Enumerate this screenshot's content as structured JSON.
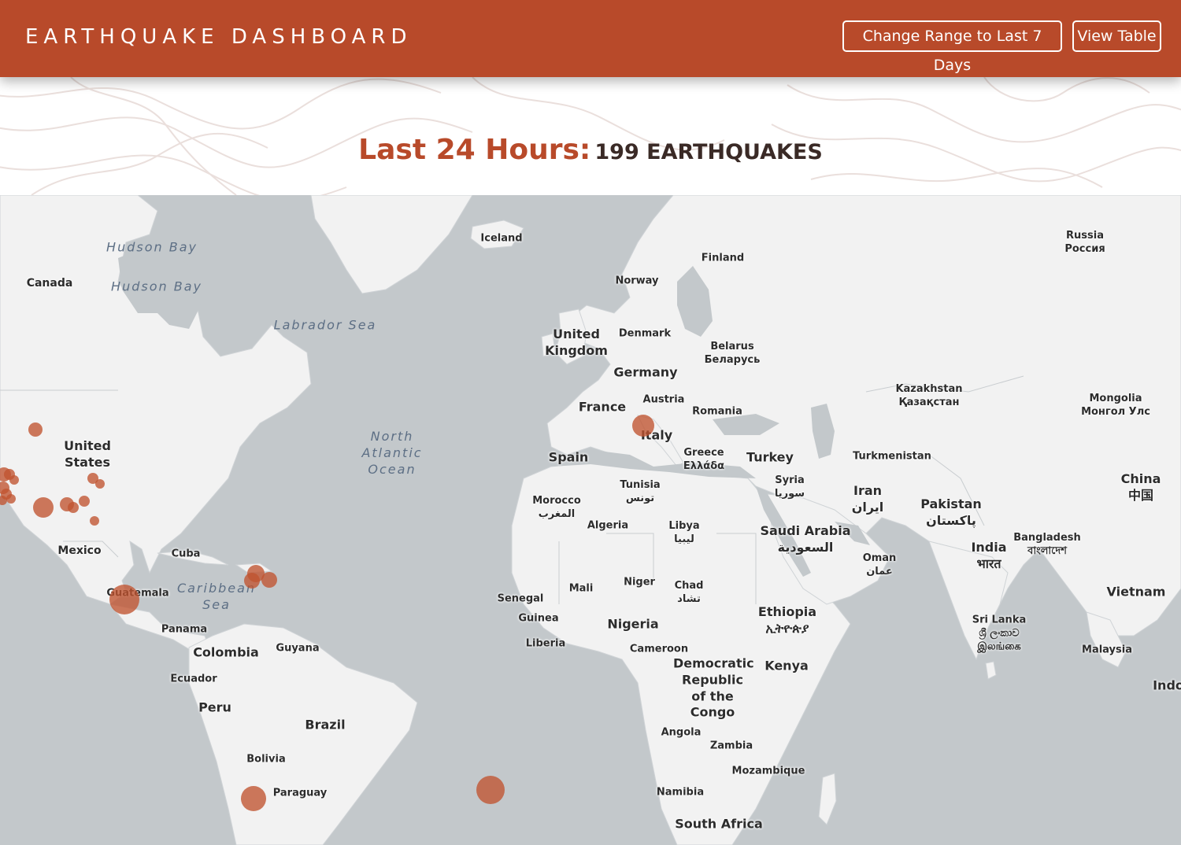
{
  "header": {
    "title": "EARTHQUAKE DASHBOARD",
    "range_button": "Change Range to Last 7 Days",
    "table_button": "View Table",
    "bg_color": "#b84a2a"
  },
  "summary": {
    "range_label": "Last 24 Hours:",
    "count_label": "199 EARTHQUAKES",
    "accent_color": "#b84a2a"
  },
  "map": {
    "ocean_color": "#c3c8cb",
    "land_color": "#f2f2f2",
    "marker_color": "#c0532f",
    "labels": {
      "canada": "Canada",
      "united_states": "United States",
      "mexico": "Mexico",
      "cuba": "Cuba",
      "guatemala": "Guatemala",
      "panama": "Panama",
      "colombia": "Colombia",
      "guyana": "Guyana",
      "ecuador": "Ecuador",
      "peru": "Peru",
      "brazil": "Brazil",
      "bolivia": "Bolivia",
      "paraguay": "Paraguay",
      "iceland": "Iceland",
      "finland": "Finland",
      "norway": "Norway",
      "united_kingdom": "United Kingdom",
      "denmark": "Denmark",
      "belarus": "Belarus",
      "belarus_native": "Беларусь",
      "germany": "Germany",
      "france": "France",
      "austria": "Austria",
      "romania": "Romania",
      "italy": "Italy",
      "spain": "Spain",
      "greece": "Greece",
      "greece_native": "Ελλάδα",
      "turkey": "Turkey",
      "syria": "Syria",
      "syria_native": "سوريا",
      "tunisia": "Tunisia",
      "tunisia_native": "تونس",
      "morocco": "Morocco",
      "morocco_native": "المغرب",
      "algeria": "Algeria",
      "libya": "Libya",
      "libya_native": "ليبيا",
      "russia": "Russia",
      "russia_native": "Россия",
      "kazakhstan": "Kazakhstan",
      "kazakhstan_native": "Қазақстан",
      "mongolia": "Mongolia",
      "mongolia_native": "Монгол Улс",
      "turkmenistan": "Turkmenistan",
      "iran": "Iran",
      "iran_native": "ایران",
      "pakistan": "Pakistan",
      "pakistan_native": "پاکستان",
      "china": "China",
      "china_native": "中国",
      "saudi_arabia": "Saudi Arabia",
      "saudi_arabia_native": "السعودية",
      "oman": "Oman",
      "oman_native": "عمان",
      "india": "India",
      "india_native": "भारत",
      "bangladesh": "Bangladesh",
      "bangladesh_native": "বাংলাদেশ",
      "vietnam": "Vietnam",
      "sri_lanka": "Sri Lanka",
      "sri_lanka_native_1": "ශ්‍රී ලංකාව",
      "sri_lanka_native_2": "இலங்கை",
      "malaysia": "Malaysia",
      "indonesia_partial": "Indo",
      "senegal": "Senegal",
      "mali": "Mali",
      "niger": "Niger",
      "chad": "Chad",
      "chad_native": "تشاد",
      "guinea": "Guinea",
      "nigeria": "Nigeria",
      "liberia": "Liberia",
      "cameroon": "Cameroon",
      "ethiopia": "Ethiopia",
      "ethiopia_native": "ኢትዮጵያ",
      "kenya": "Kenya",
      "drc": "Democratic Republic of the Congo",
      "angola": "Angola",
      "zambia": "Zambia",
      "mozambique": "Mozambique",
      "namibia": "Namibia",
      "south_africa": "South Africa"
    },
    "seas": {
      "hudson_bay": "Hudson Bay",
      "labrador_sea": "Labrador Sea",
      "north_atlantic": "North Atlantic Ocean",
      "caribbean": "Caribbean Sea"
    }
  }
}
